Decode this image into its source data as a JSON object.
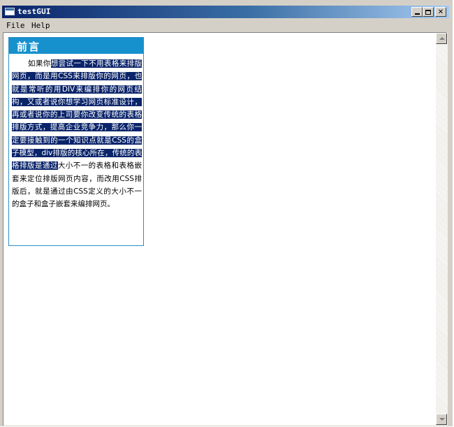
{
  "window": {
    "title": "testGUI",
    "minimize_label": "",
    "maximize_label": "",
    "close_label": "✕"
  },
  "menubar": {
    "items": [
      {
        "label": "File"
      },
      {
        "label": "Help"
      }
    ]
  },
  "box": {
    "title": "前言",
    "text_before": "如果你",
    "text_selected": "想尝试一下不用表格来排版网页，而是用CSS来排版你的网页，也就是常听的用DIV来编排你的网页结构，又或者说你想学习网页标准设计，再或者说你的上司要你改变传统的表格排版方式，提高企业竞争力，那么你一定要接触到的一个知识点就是CSS的盒子模型，div排版的核心所在，传统的表格排版是通过",
    "text_after": "大小不一的表格和表格嵌套来定位排版网页内容，而改用CSS排版后，就是通过由CSS定义的大小不一的盒子和盒子嵌套来编排网页。"
  },
  "colors": {
    "titlebar_start": "#0a246a",
    "titlebar_end": "#a6caf0",
    "box_header": "#1691cd",
    "selection": "#0a246a"
  },
  "icons": {
    "app": "window-app-icon",
    "scroll_up": "scroll-up-arrow-icon",
    "scroll_down": "scroll-down-arrow-icon"
  }
}
